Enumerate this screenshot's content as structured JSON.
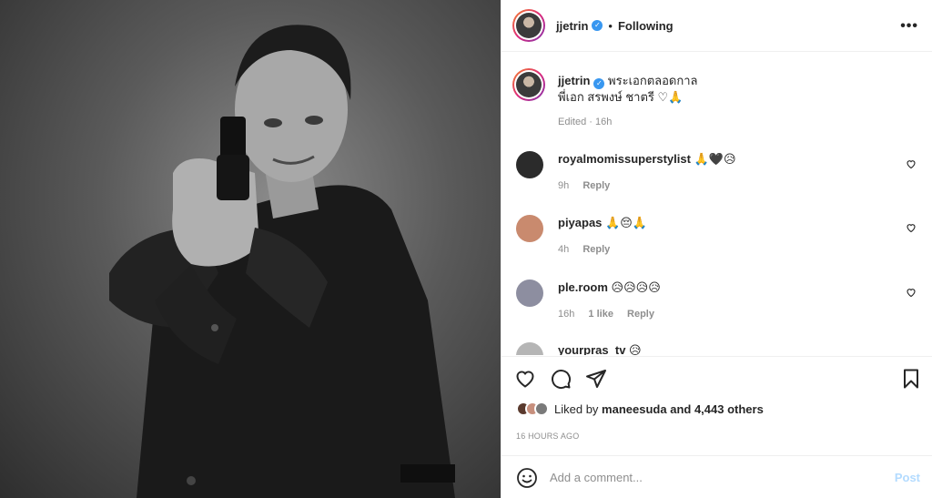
{
  "post": {
    "author": "jjetrin",
    "follow_state": "Following",
    "more_icon": "more-options-icon",
    "photo_alt": "Black and white portrait of a man aiming a pistol"
  },
  "caption": {
    "username": "jjetrin",
    "line1": "พระเอกตลอดกาล",
    "line2": "พี่เอก สรพงษ์ ชาตรี ♡🙏",
    "meta": "Edited · 16h"
  },
  "comments": [
    {
      "username": "royalmomissuperstylist",
      "text": "🙏🖤😥",
      "time": "9h",
      "likes": "",
      "reply": "Reply",
      "avatar_color": "#2b2b2b"
    },
    {
      "username": "piyapas",
      "text": "🙏😔🙏",
      "time": "4h",
      "likes": "",
      "reply": "Reply",
      "avatar_color": "#c98a6e"
    },
    {
      "username": "ple.room",
      "text": "😥😥😥😥",
      "time": "16h",
      "likes": "1 like",
      "reply": "Reply",
      "avatar_color": "#8d8ea0"
    },
    {
      "username": "yourpras_tv",
      "text": "😥",
      "time": "",
      "likes": "",
      "reply": "",
      "avatar_color": "#b5b5b5"
    }
  ],
  "actions": {
    "like_icon": "heart-icon",
    "comment_icon": "comment-icon",
    "share_icon": "share-icon",
    "save_icon": "bookmark-icon"
  },
  "likes": {
    "prefix": "Liked by",
    "user": "maneesuda",
    "suffix": "and 4,443 others",
    "mini_colors": [
      "#5a3a2e",
      "#c78f7d",
      "#7a7a7a"
    ]
  },
  "timestamp": "16 HOURS AGO",
  "add_comment": {
    "placeholder": "Add a comment...",
    "post_label": "Post",
    "emoji_icon": "emoji-icon"
  },
  "colors": {
    "accent": "#3897f0",
    "post_disabled": "#b3dbff",
    "secondary_text": "#8e8e8e",
    "border": "#efefef"
  }
}
